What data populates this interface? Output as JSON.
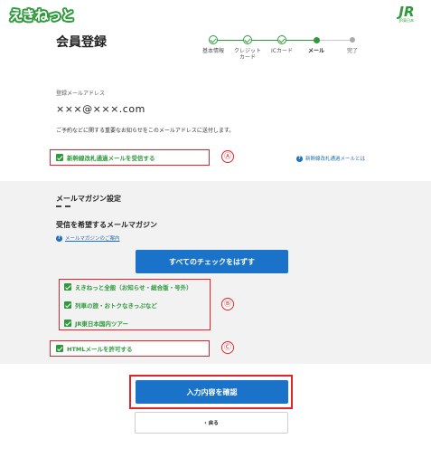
{
  "header": {
    "logo_text": "えきねっと",
    "brand_logo": {
      "mark": "JR",
      "sub": "JR東日本"
    }
  },
  "page_title": "会員登録",
  "steps": [
    {
      "label": "基本情報",
      "state": "done"
    },
    {
      "label": "クレジット\nカード",
      "state": "done"
    },
    {
      "label": "ICカード",
      "state": "done"
    },
    {
      "label": "メール",
      "state": "current"
    },
    {
      "label": "完了",
      "state": "todo"
    }
  ],
  "email": {
    "label": "登録メールアドレス",
    "value": "×××@×××.com",
    "note": "ご予約などに関する重要なお知らせをこのメールアドレスに送付します。"
  },
  "shinkansen_checkbox": {
    "label": "新幹線改札通過メールを受信する",
    "checked": true,
    "marker": "Ⓐ"
  },
  "shinkansen_help_link": "新幹線改札通過メールとは",
  "newsletter": {
    "section_title": "メールマガジン設定",
    "subsection_title": "受信を希望するメールマガジン",
    "guide_link": "メールマガジンのご案内",
    "uncheck_all_button": "すべてのチェックをはずす",
    "items": [
      {
        "label": "えきねっと全般（お知らせ・総合版・号外）",
        "checked": true
      },
      {
        "label": "列車の旅・おトクなきっぷなど",
        "checked": true
      },
      {
        "label": "JR東日本国内ツアー",
        "checked": true
      }
    ],
    "group_marker": "Ⓑ"
  },
  "html_checkbox": {
    "label": "HTMLメールを許可する",
    "checked": true,
    "marker": "Ⓒ"
  },
  "confirm_button": "入力内容を確認",
  "back_button": "戻る",
  "colors": {
    "brand_green": "#2e9a3c",
    "accent_blue": "#1a73c9",
    "annotation_red": "#e1232a",
    "band_gray": "#f2f2f2"
  },
  "icons": {
    "check": "check-icon",
    "help": "question-circle-icon",
    "back": "chevron-left-icon"
  }
}
